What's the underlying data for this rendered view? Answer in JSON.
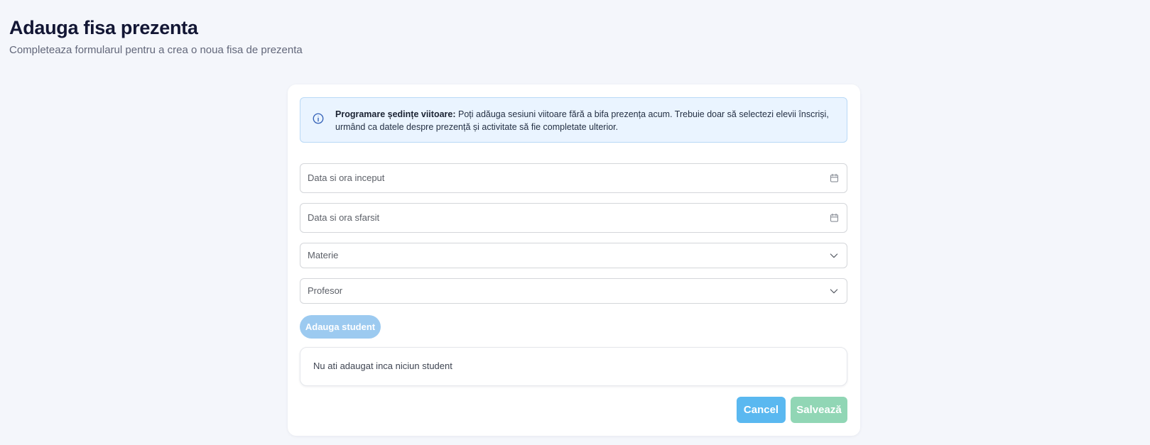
{
  "header": {
    "title": "Adauga fisa prezenta",
    "subtitle": "Completeaza formularul pentru a crea o noua fisa de prezenta"
  },
  "info": {
    "icon": "info-icon",
    "title": "Programare ședințe viitoare:",
    "text": " Poți adăuga sesiuni viitoare fără a bifa prezența acum. Trebuie doar să selectezi elevii înscriși, urmând ca datele despre prezență și activitate să fie completate ulterior."
  },
  "fields": {
    "start_datetime": "Data si ora inceput",
    "end_datetime": "Data si ora sfarsit",
    "subject": "Materie",
    "teacher": "Profesor"
  },
  "buttons": {
    "add_student": "Adauga student",
    "cancel": "Cancel",
    "save": "Salvează"
  },
  "students": {
    "empty_message": "Nu ati adaugat inca niciun student"
  },
  "colors": {
    "background": "#f4f6fb",
    "info_background": "#eaf4ff",
    "info_border": "#b9d9f6",
    "add_student_button": "#9ccaf0",
    "cancel_button": "#5ab8f0",
    "save_button": "#91d6b5"
  },
  "icons": {
    "date_picker": "calendar-icon",
    "dropdown": "chevron-down-icon"
  }
}
